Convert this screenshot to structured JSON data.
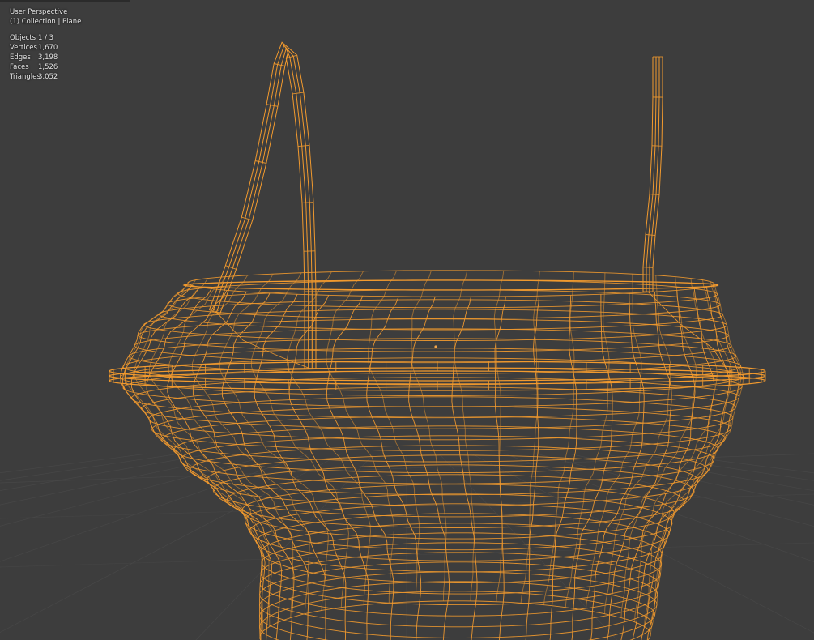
{
  "viewport": {
    "view_name": "User Perspective",
    "collection_label": "(1) Collection | Plane"
  },
  "stats": [
    {
      "label": "Objects",
      "value": "1 / 3"
    },
    {
      "label": "Vertices",
      "value": "1,670"
    },
    {
      "label": "Edges",
      "value": "3,198"
    },
    {
      "label": "Faces",
      "value": "1,526"
    },
    {
      "label": "Triangles",
      "value": "3,052"
    }
  ],
  "colors": {
    "background": "#3d3d3d",
    "wire": "#f29a2e",
    "grid": "#4a4a4a",
    "text": "#e6e6e6"
  }
}
